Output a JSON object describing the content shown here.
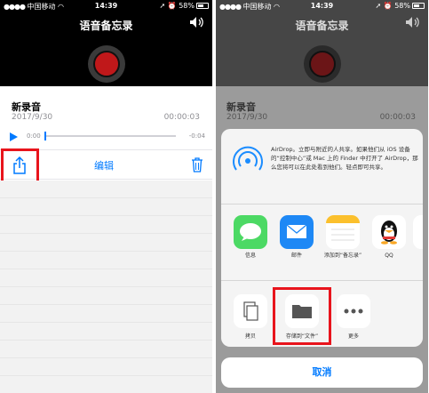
{
  "left": {
    "status": {
      "carrier": "中国移动",
      "time": "14:39",
      "battery": "58%"
    },
    "app_title": "语音备忘录",
    "recording": {
      "title": "新录音",
      "date": "2017/9/30",
      "duration": "00:00:03",
      "elapsed": "0:00",
      "remaining": "-0:04"
    },
    "actions": {
      "edit_label": "编辑"
    }
  },
  "right": {
    "status": {
      "carrier": "中国移动",
      "time": "14:39",
      "battery": "58%"
    },
    "app_title": "语音备忘录",
    "recording": {
      "title": "新录音",
      "date": "2017/9/30",
      "duration": "00:00:03"
    },
    "airdrop": {
      "text": "AirDrop。立即与附近的人共享。如果他们从 iOS 设备的“控制中心”或 Mac 上的 Finder 中打开了 AirDrop，那么您将可以在此处看到他们。轻点即可共享。"
    },
    "apps": [
      {
        "label": "信息"
      },
      {
        "label": "邮件"
      },
      {
        "label": "添加到“备忘录”"
      },
      {
        "label": "QQ"
      }
    ],
    "actions": [
      {
        "label": "拷贝"
      },
      {
        "label": "存储到“文件”"
      },
      {
        "label": "更多"
      }
    ],
    "cancel_label": "取消"
  },
  "colors": {
    "accent": "#007aff",
    "highlight": "#e8141c",
    "record": "#c0181a"
  }
}
